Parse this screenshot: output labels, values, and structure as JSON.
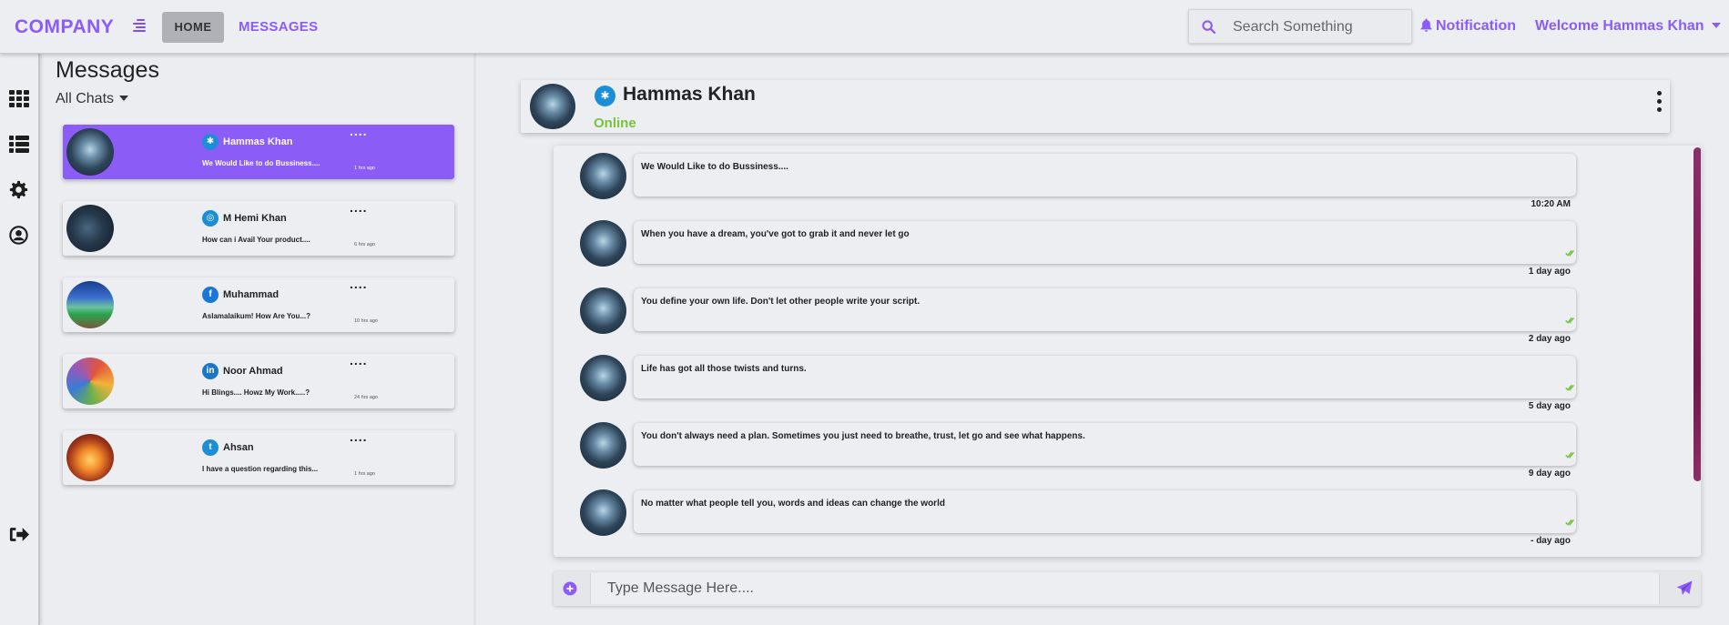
{
  "brand": "COMPANY",
  "nav": {
    "home": "HOME",
    "messages": "MESSAGES"
  },
  "search": {
    "placeholder": "Search Something"
  },
  "notification": "Notification",
  "welcome": "Welcome Hammas Khan",
  "sidebar_icons": [
    "apps-grid-icon",
    "list-icon",
    "settings-gear-icon",
    "user-circle-icon",
    "logout-icon"
  ],
  "messages_panel": {
    "title": "Messages",
    "filter": "All Chats",
    "chats": [
      {
        "name": "Hammas Khan",
        "preview": "We Would Like to do Bussiness....",
        "time": "1 hrs ago",
        "network": "yelp",
        "net_color": "#1b8ed6",
        "active": true
      },
      {
        "name": "M Hemi Khan",
        "preview": "How can i Avail Your product....",
        "time": "6 hrs ago",
        "network": "instagram",
        "net_color": "#1b8ed6",
        "active": false
      },
      {
        "name": "Muhammad",
        "preview": "Aslamalaikum! How Are You...?",
        "time": "10 hrs ago",
        "network": "facebook",
        "net_color": "#1b77d6",
        "active": false
      },
      {
        "name": "Noor Ahmad",
        "preview": "Hi Blings.... Howz My Work.....?",
        "time": "24 hrs ago",
        "network": "linkedin",
        "net_color": "#1b77c4",
        "active": false
      },
      {
        "name": "Ahsan",
        "preview": "I have a question regarding this...",
        "time": "1 hrs ago",
        "network": "twitter",
        "net_color": "#1b8ed6",
        "active": false
      }
    ]
  },
  "conversation": {
    "name": "Hammas Khan",
    "status": "Online",
    "messages": [
      {
        "text": "We Would Like to do Bussiness....",
        "time": "10:20 AM",
        "ticks": false
      },
      {
        "text": "When you have a dream, you've got to grab it and never let go",
        "time": "1 day ago",
        "ticks": true
      },
      {
        "text": "You define your own life. Don't let other people write your script.",
        "time": "2 day ago",
        "ticks": true
      },
      {
        "text": "Life has got all those twists and turns.",
        "time": "5 day ago",
        "ticks": true
      },
      {
        "text": "You don't always need a plan. Sometimes you just need to breathe, trust, let go and see what happens.",
        "time": "9 day ago",
        "ticks": true
      },
      {
        "text": "No matter what people tell you, words and ideas can change the world",
        "time": "- day ago",
        "ticks": true
      }
    ]
  },
  "composer": {
    "placeholder": "Type Message Here...."
  },
  "colors": {
    "accent": "#8b5cf6",
    "online": "#78c43c",
    "tick": "#78c43c"
  }
}
